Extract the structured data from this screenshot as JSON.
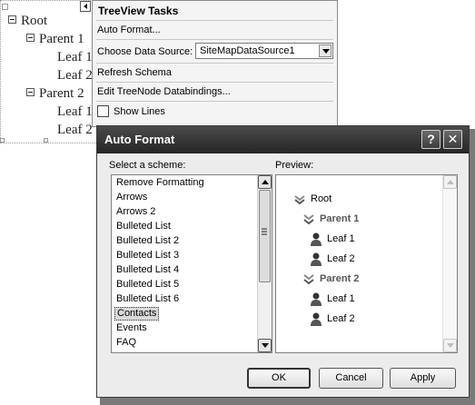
{
  "designer_tree": {
    "nodes": [
      {
        "label": "Root",
        "expander": true
      },
      {
        "label": "Parent 1",
        "expander": true
      },
      {
        "label": "Leaf 1",
        "expander": false
      },
      {
        "label": "Leaf 2",
        "expander": false
      },
      {
        "label": "Parent 2",
        "expander": true
      },
      {
        "label": "Leaf 1",
        "expander": false
      },
      {
        "label": "Leaf 2",
        "expander": false
      }
    ]
  },
  "tasks_panel": {
    "title": "TreeView Tasks",
    "auto_format": "Auto Format...",
    "data_source_label": "Choose Data Source:",
    "data_source_value": "SiteMapDataSource1",
    "refresh_schema": "Refresh Schema",
    "edit_bindings": "Edit TreeNode Databindings...",
    "show_lines": "Show Lines",
    "show_lines_checked": false
  },
  "dialog": {
    "title": "Auto Format",
    "help_button": "?",
    "close_button": "✕",
    "scheme_label": "Select a scheme:",
    "preview_label": "Preview:",
    "schemes": [
      "Remove Formatting",
      "Arrows",
      "Arrows 2",
      "Bulleted List",
      "Bulleted List 2",
      "Bulleted List 3",
      "Bulleted List 4",
      "Bulleted List 5",
      "Bulleted List 6",
      "Contacts",
      "Events",
      "FAQ"
    ],
    "selected_scheme": "Contacts",
    "preview_nodes": [
      {
        "label": "Root",
        "icon": "contacts-root-icon",
        "bold": false
      },
      {
        "label": "Parent 1",
        "icon": "contacts-group-icon",
        "bold": true
      },
      {
        "label": "Leaf 1",
        "icon": "person-icon",
        "bold": false
      },
      {
        "label": "Leaf 2",
        "icon": "person-icon",
        "bold": false
      },
      {
        "label": "Parent 2",
        "icon": "contacts-group-icon",
        "bold": true
      },
      {
        "label": "Leaf 1",
        "icon": "person-icon",
        "bold": false
      },
      {
        "label": "Leaf 2",
        "icon": "person-icon",
        "bold": false
      }
    ],
    "ok_label": "OK",
    "cancel_label": "Cancel",
    "apply_label": "Apply"
  }
}
